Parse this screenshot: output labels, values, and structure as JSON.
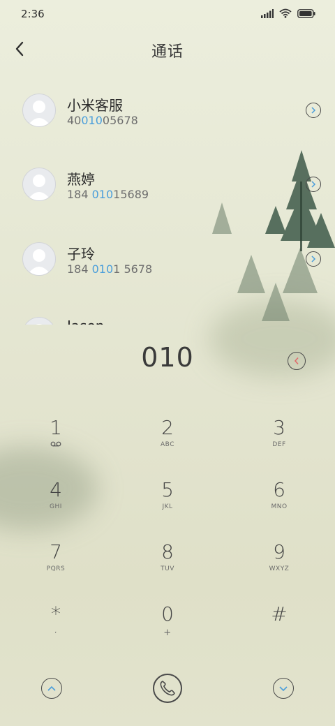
{
  "status_bar": {
    "time": "2:36",
    "icons": [
      "signal-icon",
      "wifi-icon",
      "battery-icon"
    ]
  },
  "header": {
    "title": "通话",
    "back_icon": "chevron-left-icon"
  },
  "contacts": [
    {
      "name": "小米客服",
      "number_pre": "40",
      "number_match": "010",
      "number_post": "05678"
    },
    {
      "name": "燕婷",
      "number_pre": "184 ",
      "number_match": "010",
      "number_post": "15689"
    },
    {
      "name": "子玲",
      "number_pre": "184 ",
      "number_match": "010",
      "number_post": "1 5678"
    },
    {
      "name": "Jason",
      "number_pre": "",
      "number_match": "",
      "number_post": ""
    }
  ],
  "dialer": {
    "input": "010"
  },
  "keypad": [
    {
      "digit": "1",
      "letters": ""
    },
    {
      "digit": "2",
      "letters": "ABC"
    },
    {
      "digit": "3",
      "letters": "DEF"
    },
    {
      "digit": "4",
      "letters": "GHI"
    },
    {
      "digit": "5",
      "letters": "JKL"
    },
    {
      "digit": "6",
      "letters": "MNO"
    },
    {
      "digit": "7",
      "letters": "PQRS"
    },
    {
      "digit": "8",
      "letters": "TUV"
    },
    {
      "digit": "9",
      "letters": "WXYZ"
    },
    {
      "digit": "*",
      "letters": ","
    },
    {
      "digit": "0",
      "letters": "+"
    },
    {
      "digit": "#",
      "letters": ""
    }
  ],
  "colors": {
    "accent": "#4a9edb",
    "delete_accent": "#e06a6a",
    "text": "#3a3a3a"
  }
}
